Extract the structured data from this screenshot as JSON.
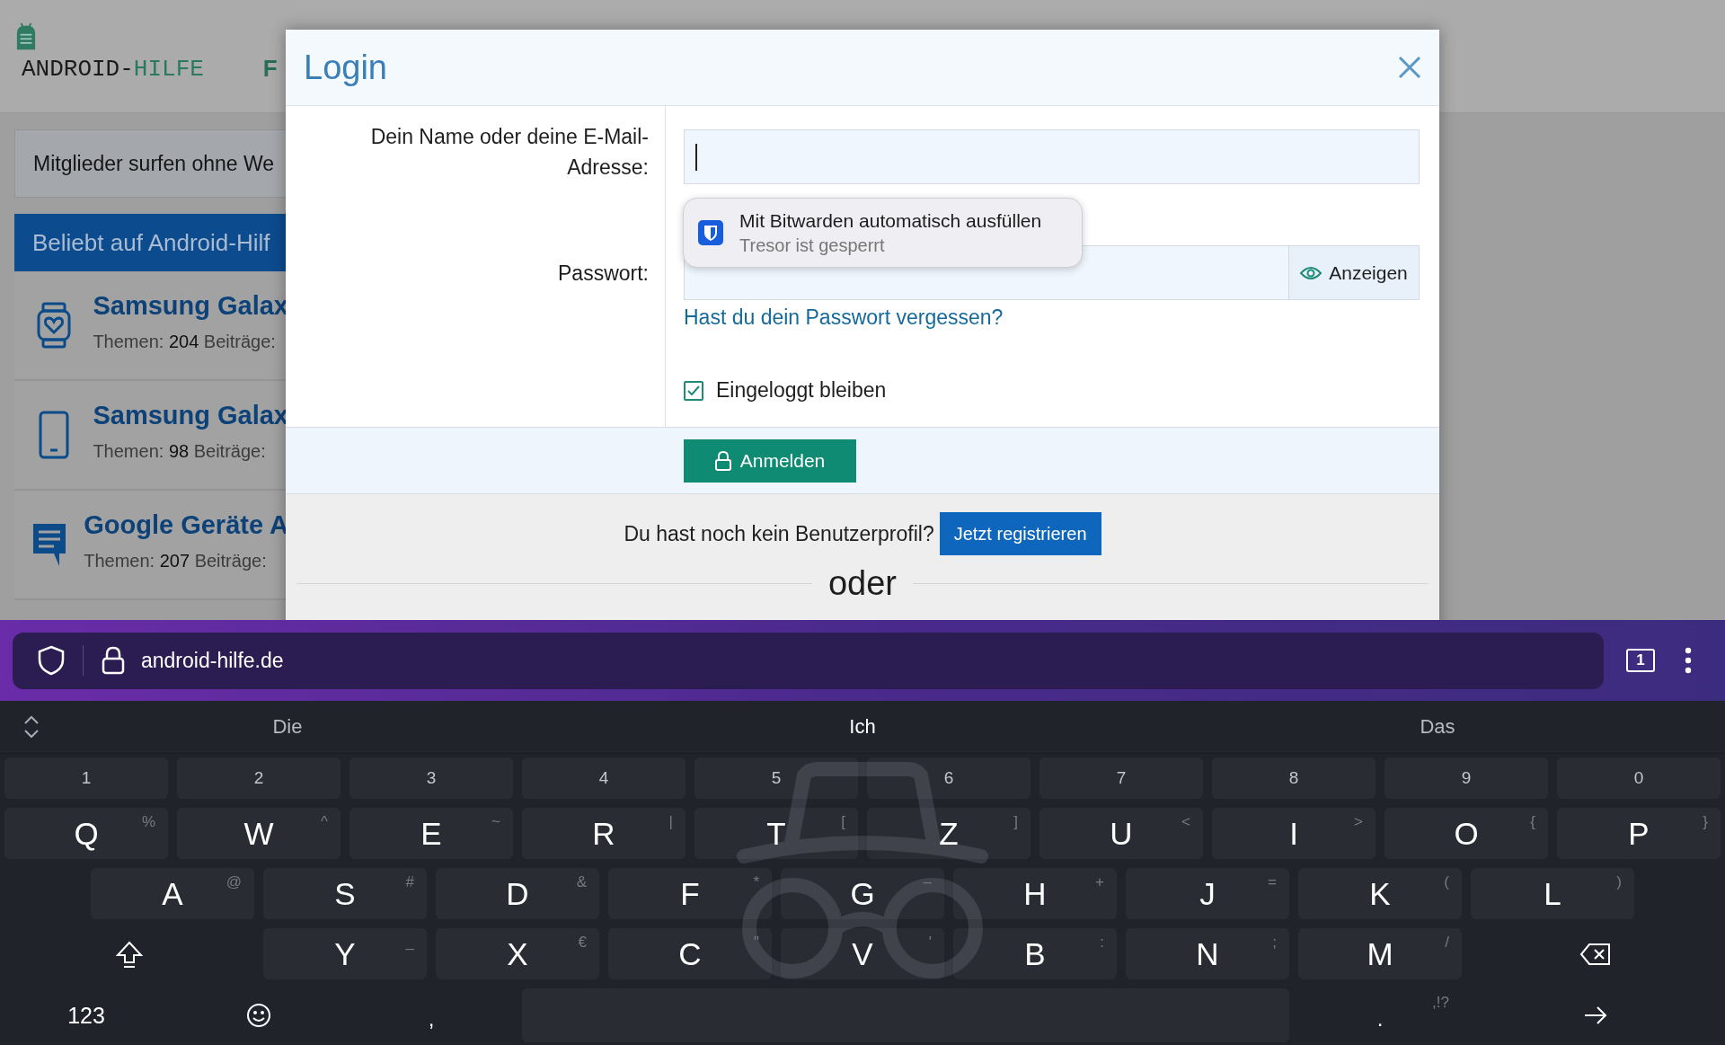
{
  "page": {
    "logo": {
      "part_1": "ANDROID-",
      "part_2": "HILFE"
    },
    "nav_item": "F",
    "notice": "Mitglieder surfen ohne We",
    "popular": {
      "title": "Beliebt auf Android-Hilf",
      "items": [
        {
          "kind": "watch",
          "title": "Samsung Galax",
          "stats": "Themen: **204** Beiträge:"
        },
        {
          "kind": "phone",
          "title": "Samsung Galax",
          "stats": "Themen: **98** Beiträge:"
        },
        {
          "kind": "chat",
          "title": "Google Geräte A",
          "stats": "Themen: **207** Beiträge:"
        }
      ]
    }
  },
  "dialog": {
    "title": "Login",
    "fields": [
      {
        "kind": "text",
        "label": "Dein Name oder deine E-Mail-Adresse:",
        "focused": true
      },
      {
        "kind": "password",
        "label": "Passwort:",
        "focused": false,
        "reveal_button": "Anzeigen"
      }
    ],
    "forgot_link": "Hast du dein Passwort vergessen?",
    "remember": {
      "label": "Eingeloggt bleiben",
      "checked": true
    },
    "submit": "Anmelden",
    "register_prompt": "Du hast noch kein Benutzerprofil?",
    "register_button": "Jetzt registrieren",
    "divider_text": "oder"
  },
  "autofill": {
    "title": "Mit Bitwarden automatisch ausfüllen",
    "subtitle": "Tresor ist gesperrt"
  },
  "browser": {
    "url": "android-hilfe.de",
    "tab_count": "1"
  },
  "keyboard": {
    "incognito": true,
    "suggestions": [
      "Die",
      "Ich",
      "Das"
    ],
    "number_row": [
      "1",
      "2",
      "3",
      "4",
      "5",
      "6",
      "7",
      "8",
      "9",
      "0"
    ],
    "rows": [
      [
        {
          "label": "Q",
          "alt": "%"
        },
        {
          "label": "W",
          "alt": "^"
        },
        {
          "label": "E",
          "alt": "~"
        },
        {
          "label": "R",
          "alt": "|"
        },
        {
          "label": "T",
          "alt": "["
        },
        {
          "label": "Z",
          "alt": "]"
        },
        {
          "label": "U",
          "alt": "<"
        },
        {
          "label": "I",
          "alt": ">"
        },
        {
          "label": "O",
          "alt": "{"
        },
        {
          "label": "P",
          "alt": "}"
        }
      ],
      [
        {
          "label": "A",
          "alt": "@"
        },
        {
          "label": "S",
          "alt": "#"
        },
        {
          "label": "D",
          "alt": "&"
        },
        {
          "label": "F",
          "alt": "*"
        },
        {
          "label": "G",
          "alt": "–"
        },
        {
          "label": "H",
          "alt": "+"
        },
        {
          "label": "J",
          "alt": "="
        },
        {
          "label": "K",
          "alt": "("
        },
        {
          "label": "L",
          "alt": ")"
        }
      ],
      [
        {
          "label": "Y",
          "alt": "_"
        },
        {
          "label": "X",
          "alt": "€"
        },
        {
          "label": "C",
          "alt": "\""
        },
        {
          "label": "V",
          "alt": "'"
        },
        {
          "label": "B",
          "alt": ":"
        },
        {
          "label": "N",
          "alt": ";"
        },
        {
          "label": "M",
          "alt": "/"
        }
      ]
    ],
    "bottom_row": [
      {
        "kind": "mode",
        "label": "123"
      },
      {
        "kind": "emoji"
      },
      {
        "kind": "plain",
        "label": ","
      },
      {
        "kind": "space"
      },
      {
        "kind": "plain",
        "label": ".",
        "alt": ",!?"
      },
      {
        "kind": "enter"
      }
    ]
  }
}
